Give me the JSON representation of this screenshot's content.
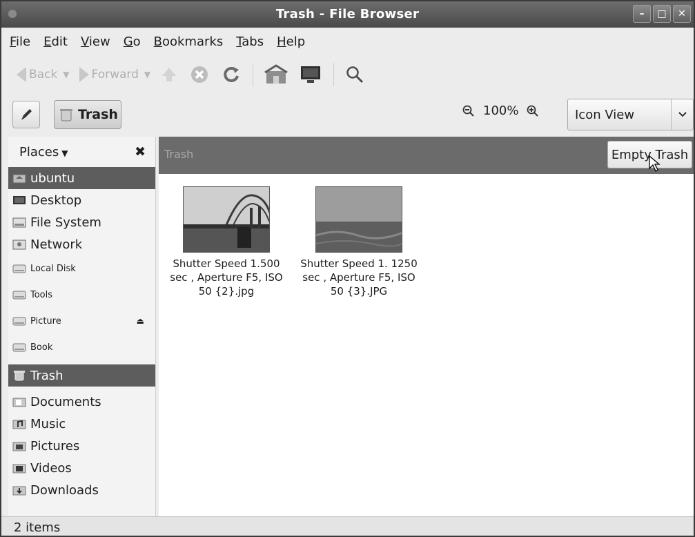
{
  "window": {
    "title": "Trash - File Browser"
  },
  "menubar": [
    {
      "pre": "",
      "u": "F",
      "post": "ile"
    },
    {
      "pre": "",
      "u": "E",
      "post": "dit"
    },
    {
      "pre": "",
      "u": "V",
      "post": "iew"
    },
    {
      "pre": "",
      "u": "G",
      "post": "o"
    },
    {
      "pre": "",
      "u": "B",
      "post": "ookmarks"
    },
    {
      "pre": "",
      "u": "T",
      "post": "abs"
    },
    {
      "pre": "",
      "u": "H",
      "post": "elp"
    }
  ],
  "toolbar": {
    "back_label": "Back",
    "forward_label": "Forward"
  },
  "location": {
    "crumb_label": "Trash",
    "zoom_level": "100%",
    "view_mode": "Icon View"
  },
  "sidebar": {
    "header": "Places",
    "items": [
      {
        "label": "ubuntu",
        "icon": "home-folder-icon",
        "selected": true,
        "small": false
      },
      {
        "label": "Desktop",
        "icon": "desktop-icon",
        "selected": false,
        "small": false
      },
      {
        "label": "File System",
        "icon": "filesystem-icon",
        "selected": false,
        "small": false
      },
      {
        "label": "Network",
        "icon": "network-icon",
        "selected": false,
        "small": false
      },
      {
        "label": "Local Disk",
        "icon": "drive-icon",
        "selected": false,
        "small": true
      },
      {
        "label": "Tools",
        "icon": "drive-icon",
        "selected": false,
        "small": true
      },
      {
        "label": "Picture",
        "icon": "drive-icon",
        "selected": false,
        "small": true,
        "eject": true
      },
      {
        "label": "Book",
        "icon": "drive-icon",
        "selected": false,
        "small": true
      },
      {
        "label": "Trash",
        "icon": "trash-icon",
        "selected": true,
        "small": false
      },
      {
        "label": "Documents",
        "icon": "documents-folder-icon",
        "selected": false,
        "small": false
      },
      {
        "label": "Music",
        "icon": "music-folder-icon",
        "selected": false,
        "small": false
      },
      {
        "label": "Pictures",
        "icon": "pictures-folder-icon",
        "selected": false,
        "small": false
      },
      {
        "label": "Videos",
        "icon": "videos-folder-icon",
        "selected": false,
        "small": false
      },
      {
        "label": "Downloads",
        "icon": "downloads-folder-icon",
        "selected": false,
        "small": false
      }
    ]
  },
  "main": {
    "location_label": "Trash",
    "empty_trash_label": "Empty Trash",
    "files": [
      {
        "name": "Shutter Speed 1.500 sec , Aperture F5, ISO 50 {2}.jpg",
        "thumb": "bridge-photo"
      },
      {
        "name": "Shutter Speed 1. 1250 sec , Aperture F5, ISO 50 {3}.JPG",
        "thumb": "sea-photo"
      }
    ]
  },
  "status": {
    "text": "2 items"
  }
}
